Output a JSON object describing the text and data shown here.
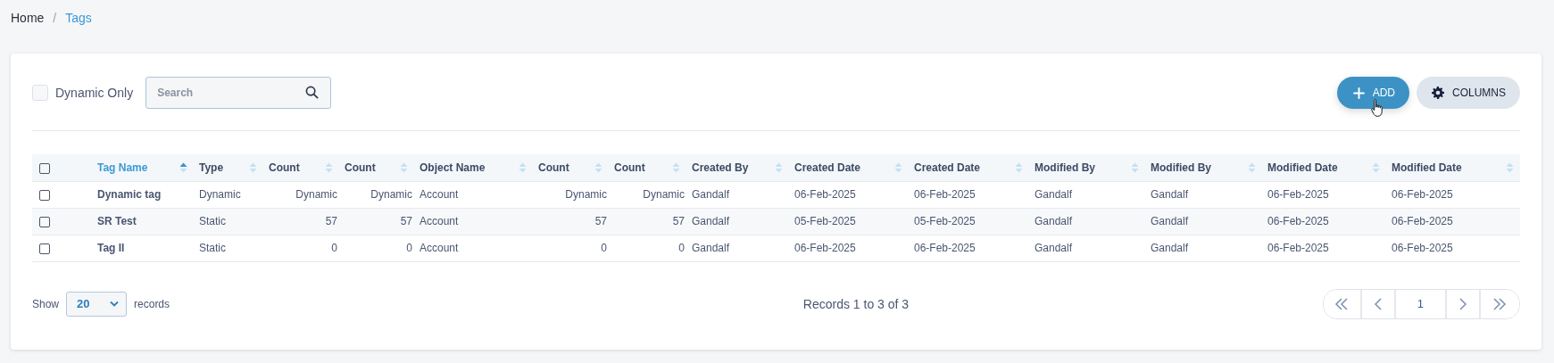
{
  "breadcrumb": [
    {
      "label": "Home",
      "current": false
    },
    {
      "separator": "/",
      "label": "Tags",
      "current": true
    }
  ],
  "filter": {
    "label": "Dynamic Only",
    "checked": false
  },
  "search": {
    "placeholder": "Search"
  },
  "buttons": [
    {
      "kind": "add",
      "label": "ADD"
    },
    {
      "kind": "columns",
      "label": "COLUMNS"
    }
  ],
  "table": {
    "select_all": {
      "checked": false
    },
    "columns": [
      {
        "label": "Tag Name",
        "sorted": true
      },
      {
        "label": "Type",
        "sorted": false
      },
      {
        "label": "Count",
        "sorted": false
      },
      {
        "label": "Count",
        "sorted": false
      },
      {
        "label": "Object Name",
        "sorted": false
      },
      {
        "label": "Count",
        "sorted": false
      },
      {
        "label": "Count",
        "sorted": false
      },
      {
        "label": "Created By",
        "sorted": false
      },
      {
        "label": "Created Date",
        "sorted": false
      },
      {
        "label": "Created Date",
        "sorted": false
      },
      {
        "label": "Modified By",
        "sorted": false
      },
      {
        "label": "Modified By",
        "sorted": false
      },
      {
        "label": "Modified Date",
        "sorted": false
      },
      {
        "label": "Modified Date",
        "sorted": false
      }
    ],
    "rows": [
      {
        "checked": false,
        "cells": [
          "Dynamic tag",
          "Dynamic",
          "Dynamic",
          "Dynamic",
          "Account",
          "Dynamic",
          "Dynamic",
          "Gandalf",
          "06-Feb-2025",
          "06-Feb-2025",
          "Gandalf",
          "Gandalf",
          "06-Feb-2025",
          "06-Feb-2025"
        ]
      },
      {
        "checked": false,
        "cells": [
          "SR Test",
          "Static",
          "57",
          "57",
          "Account",
          "57",
          "57",
          "Gandalf",
          "05-Feb-2025",
          "05-Feb-2025",
          "Gandalf",
          "Gandalf",
          "06-Feb-2025",
          "06-Feb-2025"
        ]
      },
      {
        "checked": false,
        "cells": [
          "Tag II",
          "Static",
          "0",
          "0",
          "Account",
          "0",
          "0",
          "Gandalf",
          "06-Feb-2025",
          "06-Feb-2025",
          "Gandalf",
          "Gandalf",
          "06-Feb-2025",
          "06-Feb-2025"
        ]
      }
    ]
  },
  "footer": {
    "show_label": "Show",
    "page_size": "20",
    "records_label": "records",
    "summary": "Records 1 to 3 of 3",
    "page": "1"
  }
}
